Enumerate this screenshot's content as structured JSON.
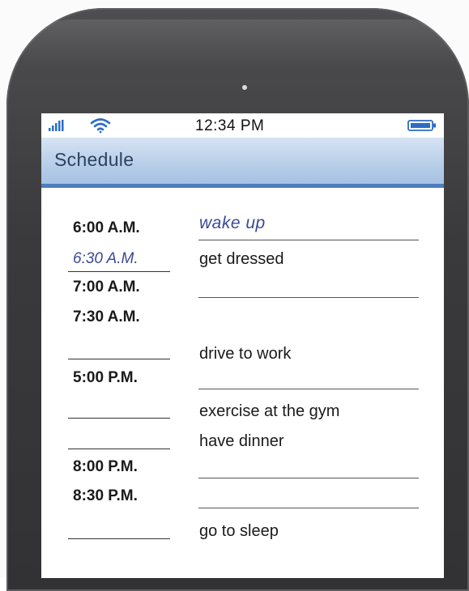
{
  "status_bar": {
    "time": "12:34 PM",
    "signal_icon": "signal-bars-icon",
    "wifi_icon": "wifi-icon",
    "battery_icon": "battery-icon"
  },
  "app": {
    "title": "Schedule",
    "accent_color": "#4d7cbf",
    "handwriting_color": "#3a4a96"
  },
  "schedule": [
    {
      "time": "6:00 A.M.",
      "activity": "wake up",
      "time_handwritten": false,
      "activity_handwritten": true
    },
    {
      "time": "6:30 A.M.",
      "activity": "get dressed",
      "time_handwritten": true,
      "activity_handwritten": false
    },
    {
      "time": "7:00 A.M.",
      "activity": "",
      "time_handwritten": false,
      "activity_handwritten": false
    },
    {
      "time": "7:30 A.M.",
      "activity": "",
      "time_handwritten": false,
      "activity_handwritten": false
    },
    {
      "time": "",
      "activity": "drive to work",
      "time_handwritten": false,
      "activity_handwritten": false
    },
    {
      "time": "5:00 P.M.",
      "activity": "",
      "time_handwritten": false,
      "activity_handwritten": false
    },
    {
      "time": "",
      "activity": "exercise at the gym",
      "time_handwritten": false,
      "activity_handwritten": false
    },
    {
      "time": "",
      "activity": "have dinner",
      "time_handwritten": false,
      "activity_handwritten": false
    },
    {
      "time": "8:00 P.M.",
      "activity": "",
      "time_handwritten": false,
      "activity_handwritten": false
    },
    {
      "time": "8:30 P.M.",
      "activity": "",
      "time_handwritten": false,
      "activity_handwritten": false
    },
    {
      "time": "",
      "activity": "go to sleep",
      "time_handwritten": false,
      "activity_handwritten": false
    }
  ]
}
